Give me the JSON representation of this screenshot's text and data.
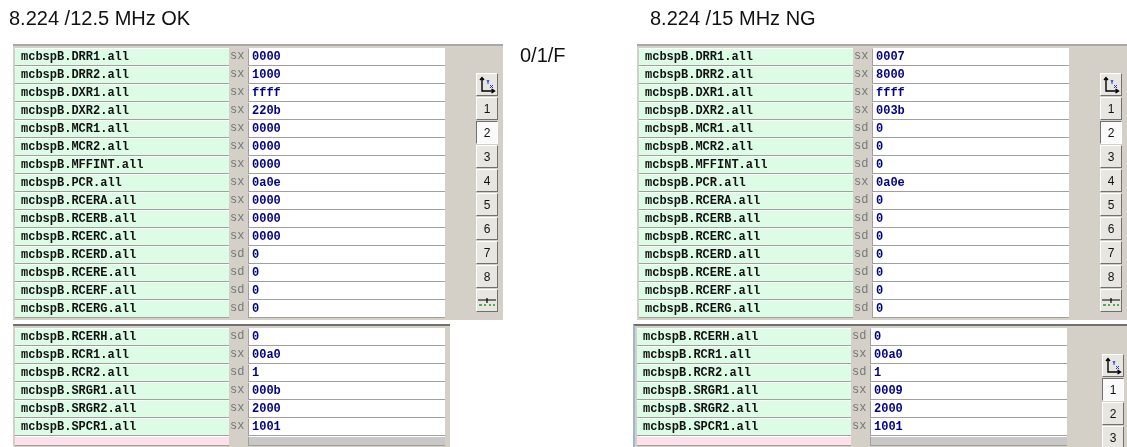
{
  "note": "0/1/F",
  "panels": [
    {
      "title": "8.224  /12.5 MHz OK",
      "upper": {
        "axes_button": true,
        "bottom_button": true,
        "rows": [
          {
            "name": "mcbspB.DRR1.all",
            "format": "sx",
            "value": "0000"
          },
          {
            "name": "mcbspB.DRR2.all",
            "format": "sx",
            "value": "1000"
          },
          {
            "name": "mcbspB.DXR1.all",
            "format": "sx",
            "value": "ffff"
          },
          {
            "name": "mcbspB.DXR2.all",
            "format": "sx",
            "value": "220b"
          },
          {
            "name": "mcbspB.MCR1.all",
            "format": "sx",
            "value": "0000"
          },
          {
            "name": "mcbspB.MCR2.all",
            "format": "sx",
            "value": "0000"
          },
          {
            "name": "mcbspB.MFFINT.all",
            "format": "sx",
            "value": "0000"
          },
          {
            "name": "mcbspB.PCR.all",
            "format": "sx",
            "value": "0a0e"
          },
          {
            "name": "mcbspB.RCERA.all",
            "format": "sx",
            "value": "0000"
          },
          {
            "name": "mcbspB.RCERB.all",
            "format": "sx",
            "value": "0000"
          },
          {
            "name": "mcbspB.RCERC.all",
            "format": "sx",
            "value": "0000"
          },
          {
            "name": "mcbspB.RCERD.all",
            "format": "sd",
            "value": "0"
          },
          {
            "name": "mcbspB.RCERE.all",
            "format": "sd",
            "value": "0"
          },
          {
            "name": "mcbspB.RCERF.all",
            "format": "sd",
            "value": "0"
          },
          {
            "name": "mcbspB.RCERG.all",
            "format": "sd",
            "value": "0"
          }
        ],
        "pages": [
          {
            "label": "1",
            "selected": false
          },
          {
            "label": "2",
            "selected": true
          },
          {
            "label": "3",
            "selected": false
          },
          {
            "label": "4",
            "selected": false
          },
          {
            "label": "5",
            "selected": false
          },
          {
            "label": "6",
            "selected": false
          },
          {
            "label": "7",
            "selected": false
          },
          {
            "label": "8",
            "selected": false
          }
        ]
      },
      "lower": {
        "rows": [
          {
            "name": "mcbspB.RCERH.all",
            "format": "sd",
            "value": "0"
          },
          {
            "name": "mcbspB.RCR1.all",
            "format": "sx",
            "value": "00a0"
          },
          {
            "name": "mcbspB.RCR2.all",
            "format": "sd",
            "value": "1"
          },
          {
            "name": "mcbspB.SRGR1.all",
            "format": "sx",
            "value": "000b"
          },
          {
            "name": "mcbspB.SRGR2.all",
            "format": "sx",
            "value": "2000"
          },
          {
            "name": "mcbspB.SPCR1.all",
            "format": "sx",
            "value": "1001"
          }
        ]
      }
    },
    {
      "title": "8.224  /15 MHz NG",
      "upper": {
        "axes_button": true,
        "bottom_button": true,
        "rows": [
          {
            "name": "mcbspB.DRR1.all",
            "format": "sx",
            "value": "0007"
          },
          {
            "name": "mcbspB.DRR2.all",
            "format": "sx",
            "value": "8000"
          },
          {
            "name": "mcbspB.DXR1.all",
            "format": "sx",
            "value": "ffff"
          },
          {
            "name": "mcbspB.DXR2.all",
            "format": "sx",
            "value": "003b"
          },
          {
            "name": "mcbspB.MCR1.all",
            "format": "sd",
            "value": "0"
          },
          {
            "name": "mcbspB.MCR2.all",
            "format": "sd",
            "value": "0"
          },
          {
            "name": "mcbspB.MFFINT.all",
            "format": "sd",
            "value": "0"
          },
          {
            "name": "mcbspB.PCR.all",
            "format": "sx",
            "value": "0a0e"
          },
          {
            "name": "mcbspB.RCERA.all",
            "format": "sd",
            "value": "0"
          },
          {
            "name": "mcbspB.RCERB.all",
            "format": "sd",
            "value": "0"
          },
          {
            "name": "mcbspB.RCERC.all",
            "format": "sd",
            "value": "0"
          },
          {
            "name": "mcbspB.RCERD.all",
            "format": "sd",
            "value": "0"
          },
          {
            "name": "mcbspB.RCERE.all",
            "format": "sd",
            "value": "0"
          },
          {
            "name": "mcbspB.RCERF.all",
            "format": "sd",
            "value": "0"
          },
          {
            "name": "mcbspB.RCERG.all",
            "format": "sd",
            "value": "0"
          }
        ],
        "pages": [
          {
            "label": "1",
            "selected": false
          },
          {
            "label": "2",
            "selected": true
          },
          {
            "label": "3",
            "selected": false
          },
          {
            "label": "4",
            "selected": false
          },
          {
            "label": "5",
            "selected": false
          },
          {
            "label": "6",
            "selected": false
          },
          {
            "label": "7",
            "selected": false
          },
          {
            "label": "8",
            "selected": false
          }
        ]
      },
      "lower": {
        "axes_button": true,
        "rows": [
          {
            "name": "mcbspB.RCERH.all",
            "format": "sd",
            "value": "0"
          },
          {
            "name": "mcbspB.RCR1.all",
            "format": "sx",
            "value": "00a0"
          },
          {
            "name": "mcbspB.RCR2.all",
            "format": "sd",
            "value": "1"
          },
          {
            "name": "mcbspB.SRGR1.all",
            "format": "sx",
            "value": "0009"
          },
          {
            "name": "mcbspB.SRGR2.all",
            "format": "sx",
            "value": "2000"
          },
          {
            "name": "mcbspB.SPCR1.all",
            "format": "sx",
            "value": "1001"
          }
        ],
        "pages": [
          {
            "label": "1",
            "selected": true
          },
          {
            "label": "2",
            "selected": false
          },
          {
            "label": "3",
            "selected": false
          }
        ]
      }
    }
  ]
}
